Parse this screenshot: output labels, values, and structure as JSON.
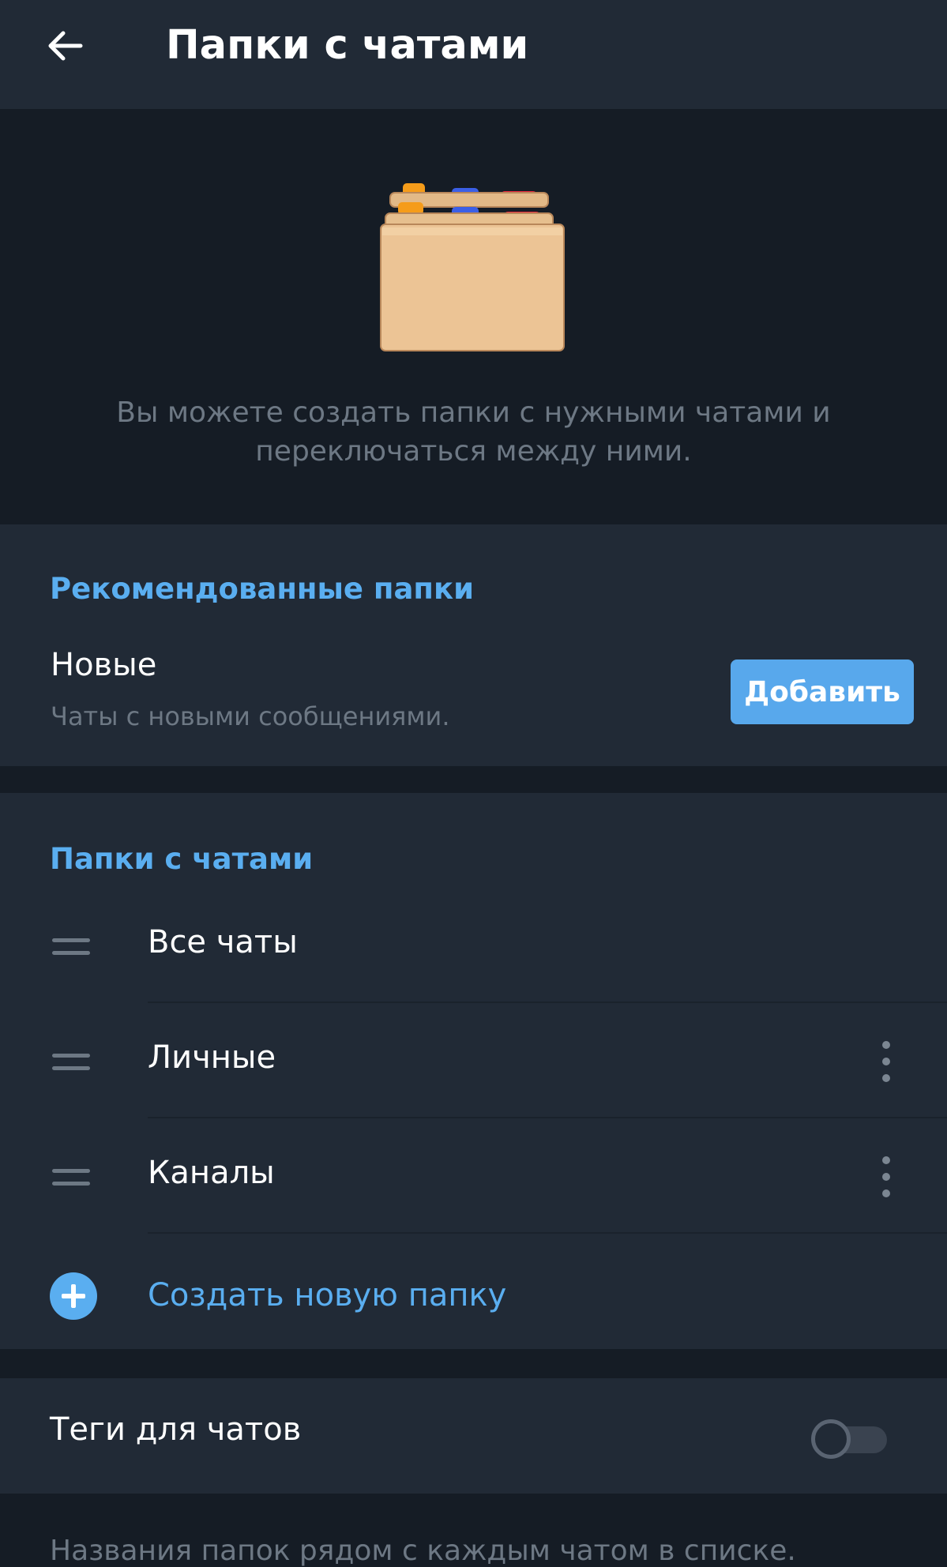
{
  "header": {
    "title": "Папки с чатами"
  },
  "hero": {
    "description": "Вы можете создать папки с нужными чатами и переключаться между ними."
  },
  "recommended": {
    "header": "Рекомендованные папки",
    "items": [
      {
        "title": "Новые",
        "subtitle": "Чаты с новыми сообщениями.",
        "button_label": "Добавить"
      }
    ]
  },
  "folders": {
    "header": "Папки с чатами",
    "items": [
      {
        "label": "Все чаты",
        "has_menu": false
      },
      {
        "label": "Личные",
        "has_menu": true
      },
      {
        "label": "Каналы",
        "has_menu": true
      }
    ],
    "create_label": "Создать новую папку"
  },
  "tags": {
    "label": "Теги для чатов",
    "enabled": false,
    "description": "Названия папок рядом с каждым чатом в списке."
  },
  "colors": {
    "accent": "#5aaef0",
    "button": "#58a8ec",
    "header_bg": "#212a36",
    "page_bg": "#151c25",
    "secondary_text": "#6d7884",
    "folder_tab_orange": "#f59c1a",
    "folder_tab_blue": "#3b5fe6",
    "folder_tab_red": "#e8283a"
  },
  "icons": {
    "back": "arrow-left-icon",
    "illustration": "folders-icon",
    "drag": "drag-handle-icon",
    "more": "more-vertical-icon",
    "add": "plus-circle-icon"
  }
}
